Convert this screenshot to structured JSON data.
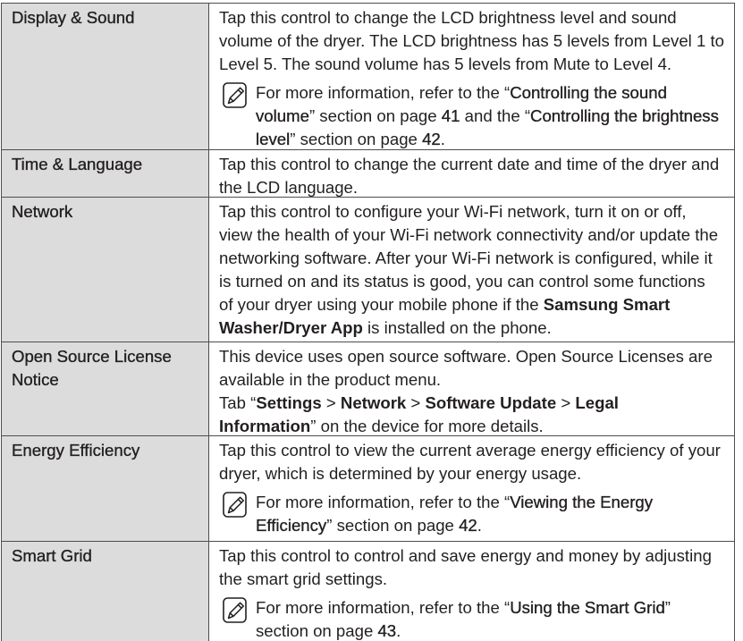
{
  "table": {
    "rows": [
      {
        "label": "Display & Sound",
        "desc": [
          "Tap this control to change the LCD brightness level and sound",
          "volume of the dryer. The LCD brightness has 5 levels from Level 1 to",
          "Level 5. The sound volume has 5 levels from Mute to Level 4."
        ],
        "note": {
          "icon": "note-pencil-icon",
          "lines": [
            [
              "For more information, refer to the “",
              "Controlling the sound"
            ],
            [
              "volume",
              "” section on page ",
              "41",
              " and the “",
              "Controlling the brightness"
            ],
            [
              "level",
              "” section on page ",
              "42",
              "."
            ]
          ]
        }
      },
      {
        "label": "Time & Language",
        "desc": [
          "Tap this control to change the current date and time of the dryer and",
          "the LCD language."
        ]
      },
      {
        "label": "Network",
        "desc": [
          "Tap this control to configure your Wi-Fi network, turn it on or off,",
          "view the health of your Wi-Fi network connectivity and/or update the",
          "networking software. After your Wi-Fi network is configured, while it",
          "is turned on and its status is good, you can control some functions",
          [
            "of your dryer using your mobile phone if the ",
            "Samsung Smart"
          ],
          [
            "Washer/Dryer App",
            " is installed on the phone."
          ]
        ]
      },
      {
        "label": "Open Source License Notice",
        "desc": [
          "This device uses open source software. Open Source Licenses are",
          "available in the product menu.",
          [
            "Tab “",
            "Settings",
            " > ",
            "Network",
            " > ",
            "Software Update",
            " > ",
            "Legal"
          ],
          [
            "Information",
            "” on the device for more details."
          ]
        ]
      },
      {
        "label": "Energy Efficiency",
        "desc": [
          "Tap this control to view the current average energy efficiency of your",
          "dryer, which is determined by your energy usage."
        ],
        "note": {
          "icon": "note-pencil-icon",
          "lines": [
            [
              "For more information, refer to the “",
              "Viewing the Energy"
            ],
            [
              "Efficiency",
              "” section on page ",
              "42",
              "."
            ]
          ]
        }
      },
      {
        "label": "Smart Grid",
        "desc": [
          "Tap this control to control and save energy and money by adjusting",
          "the smart grid settings."
        ],
        "note": {
          "icon": "note-pencil-icon",
          "lines": [
            [
              "For more information, refer to the “",
              "Using the Smart Grid",
              "”"
            ],
            [
              "section on page ",
              "43",
              "."
            ]
          ]
        }
      }
    ]
  }
}
